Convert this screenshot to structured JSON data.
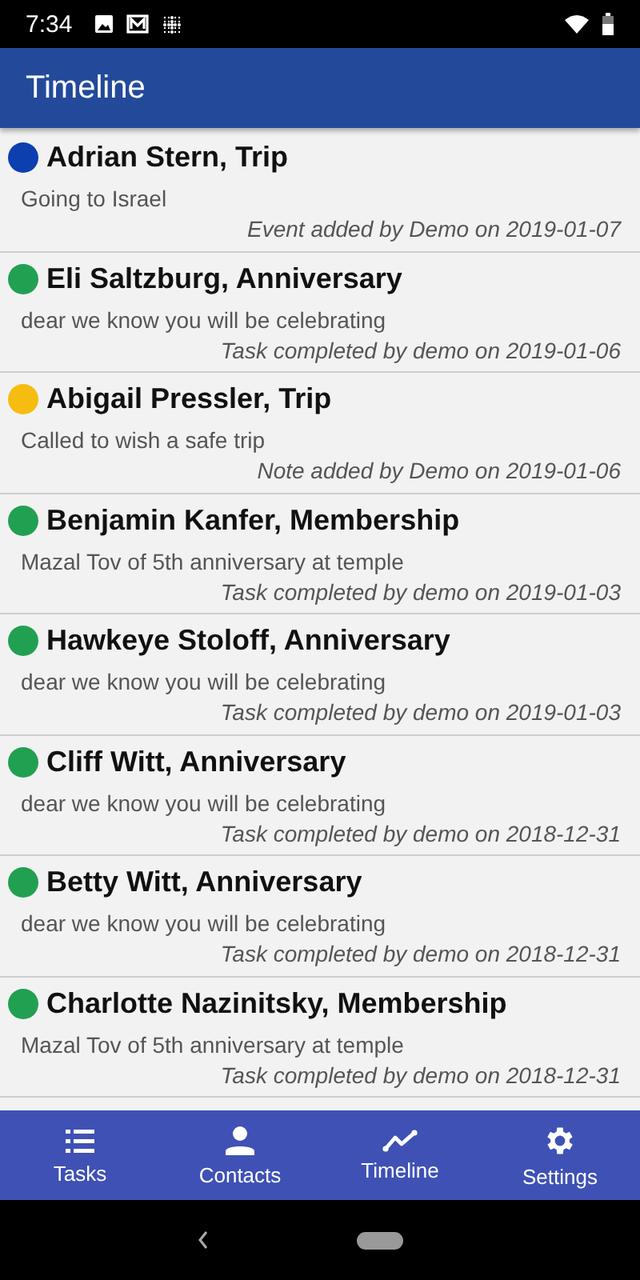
{
  "status_bar": {
    "time": "7:34"
  },
  "app_bar": {
    "title": "Timeline"
  },
  "events": [
    {
      "title": "Adrian Stern, Trip",
      "color": "#0d3fb0",
      "note": "Going to Israel",
      "footer": "Event added by Demo on 2019-01-07"
    },
    {
      "title": "Eli Saltzburg, Anniversary",
      "color": "#22a052",
      "note": "dear we know you will be celebrating",
      "footer": "Task completed by demo on 2019-01-06"
    },
    {
      "title": "Abigail Pressler, Trip",
      "color": "#f5bd10",
      "note": "Called to wish a safe trip",
      "footer": "Note added by Demo on 2019-01-06"
    },
    {
      "title": "Benjamin Kanfer, Membership",
      "color": "#22a052",
      "note": "Mazal Tov of 5th anniversary at temple",
      "footer": "Task completed by demo on 2019-01-03"
    },
    {
      "title": "Hawkeye Stoloff, Anniversary",
      "color": "#22a052",
      "note": "dear we know you will be celebrating",
      "footer": "Task completed by demo on 2019-01-03"
    },
    {
      "title": "Cliff Witt, Anniversary",
      "color": "#22a052",
      "note": "dear we know you will be celebrating",
      "footer": "Task completed by demo on 2018-12-31"
    },
    {
      "title": "Betty Witt, Anniversary",
      "color": "#22a052",
      "note": "dear we know you will be celebrating",
      "footer": "Task completed by demo on 2018-12-31"
    },
    {
      "title": "Charlotte Nazinitsky, Membership",
      "color": "#22a052",
      "note": "Mazal Tov of 5th anniversary at temple",
      "footer": "Task completed by demo on 2018-12-31"
    }
  ],
  "bottom_nav": [
    {
      "label": "Tasks",
      "kind": "list"
    },
    {
      "label": "Contacts",
      "kind": "person"
    },
    {
      "label": "Timeline",
      "kind": "trend"
    },
    {
      "label": "Settings",
      "kind": "gear"
    }
  ]
}
